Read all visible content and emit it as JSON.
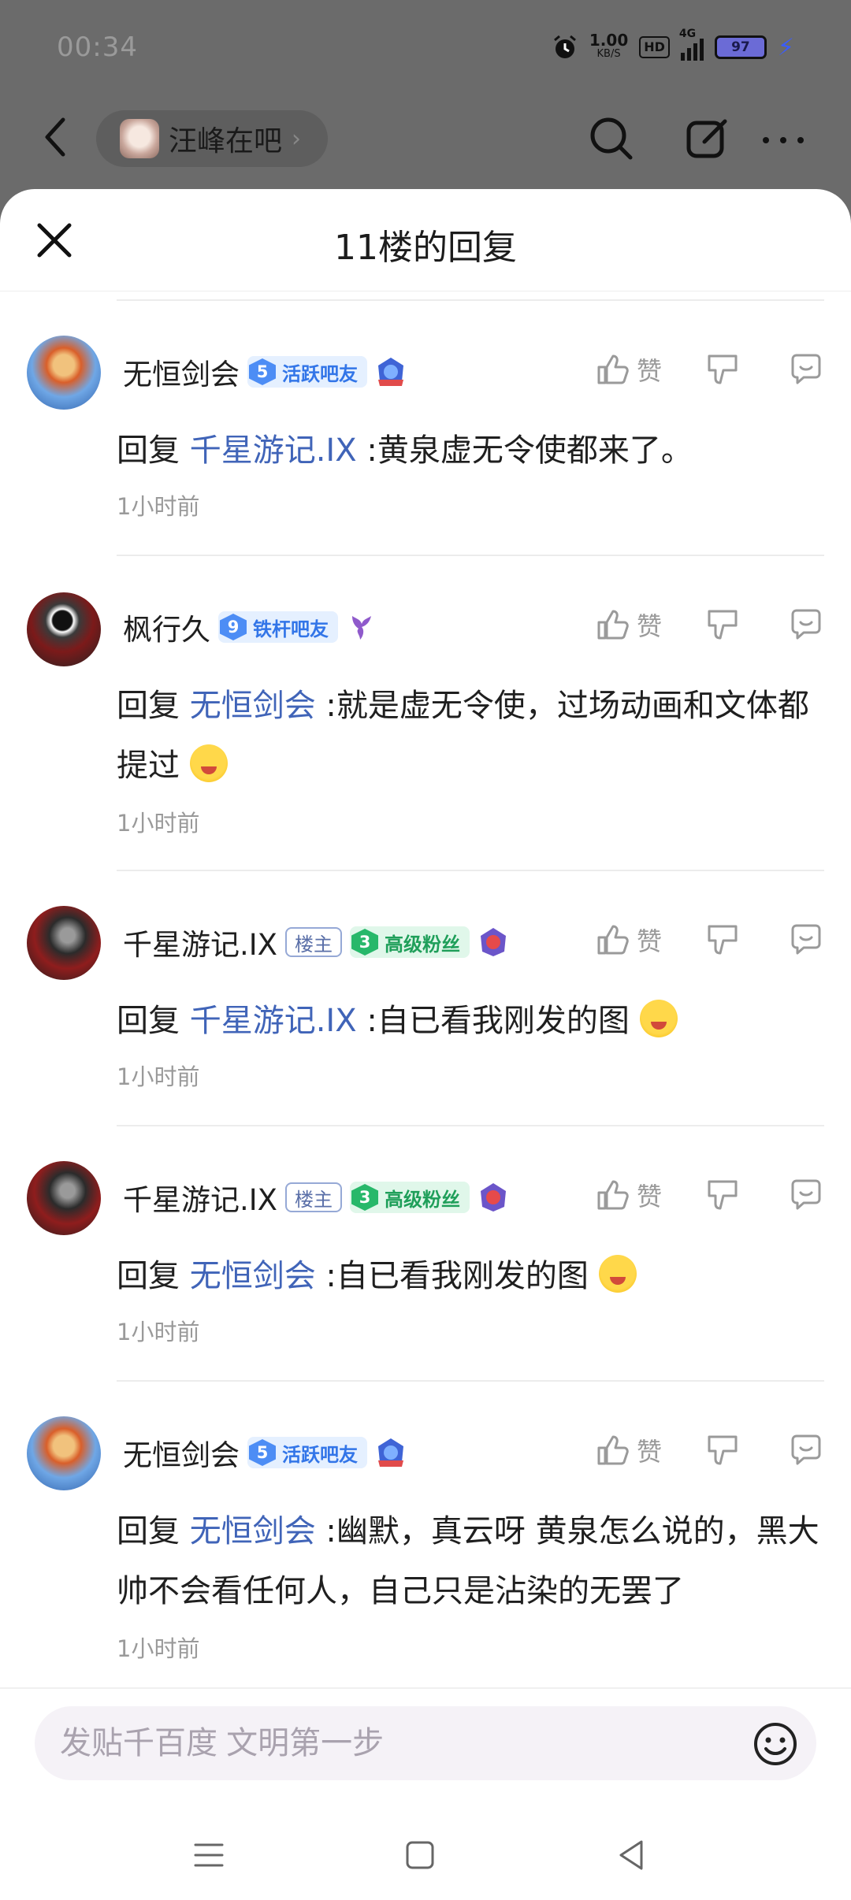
{
  "status_bar": {
    "time": "00:34",
    "net_speed": "1.00",
    "net_unit": "KB/S",
    "hd": "HD",
    "signal": "4G",
    "battery": "97"
  },
  "app_bar": {
    "forum_name": "汪峰在吧",
    "chevron": "›"
  },
  "sheet": {
    "title": "11楼的回复"
  },
  "replies": [
    {
      "username": "无恒剑会",
      "level_num": "5",
      "level_label": "活跃吧友",
      "level_style": "blue",
      "owner_badge": "",
      "reply_prefix": "回复",
      "reply_to": "千星游记.IX",
      "text": " :黄泉虚无令使都来了。",
      "time": "1小时前",
      "like_label": "赞"
    },
    {
      "username": "枫行久",
      "level_num": "9",
      "level_label": "铁杆吧友",
      "level_style": "blue",
      "owner_badge": "",
      "reply_prefix": "回复",
      "reply_to": "无恒剑会",
      "text": " :就是虚无令使，过场动画和文体都提过",
      "time": "1小时前",
      "like_label": "赞"
    },
    {
      "username": "千星游记.IX",
      "level_num": "3",
      "level_label": "高级粉丝",
      "level_style": "green",
      "owner_badge": "楼主",
      "reply_prefix": "回复",
      "reply_to": "千星游记.IX",
      "text": " :自已看我刚发的图",
      "time": "1小时前",
      "like_label": "赞"
    },
    {
      "username": "千星游记.IX",
      "level_num": "3",
      "level_label": "高级粉丝",
      "level_style": "green",
      "owner_badge": "楼主",
      "reply_prefix": "回复",
      "reply_to": "无恒剑会",
      "text": " :自已看我刚发的图",
      "time": "1小时前",
      "like_label": "赞"
    },
    {
      "username": "无恒剑会",
      "level_num": "5",
      "level_label": "活跃吧友",
      "level_style": "blue",
      "owner_badge": "",
      "reply_prefix": "回复",
      "reply_to": "无恒剑会",
      "text": " :幽默，真云呀 黄泉怎么说的，黑大帅不会看任何人，自己只是沾染的无罢了",
      "time": "1小时前",
      "like_label": "赞"
    }
  ],
  "composer": {
    "placeholder": "发贴千百度 文明第一步"
  },
  "colors": {
    "link": "#4064b8",
    "level_blue": "#3275e8",
    "level_green": "#1f9f5a",
    "meta_gray": "#9a9a9a"
  }
}
